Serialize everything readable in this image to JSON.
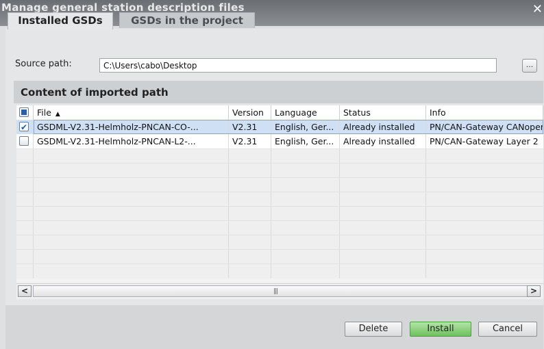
{
  "window": {
    "title": "Manage general station description files"
  },
  "tabs": [
    {
      "label": "Installed GSDs",
      "active": true
    },
    {
      "label": "GSDs in the project",
      "active": false
    }
  ],
  "source": {
    "label": "Source path:",
    "value": "C:\\Users\\cabo\\Desktop",
    "browse_label": "..."
  },
  "section": {
    "title": "Content of imported path"
  },
  "table": {
    "columns": [
      "File",
      "Version",
      "Language",
      "Status",
      "Info"
    ],
    "sort": {
      "column": "File",
      "direction": "ascending"
    },
    "rows": [
      {
        "checked": true,
        "selected": true,
        "file": "GSDML-V2.31-Helmholz-PNCAN-CO-...",
        "version": "V2.31",
        "language": "English, Ger...",
        "status": "Already installed",
        "info": "PN/CAN-Gateway CANopen"
      },
      {
        "checked": false,
        "selected": false,
        "file": "GSDML-V2.31-Helmholz-PNCAN-L2-...",
        "version": "V2.31",
        "language": "English, Ger...",
        "status": "Already installed",
        "info": "PN/CAN-Gateway Layer 2"
      }
    ]
  },
  "buttons": {
    "delete": "Delete",
    "install": "Install",
    "cancel": "Cancel"
  },
  "colors": {
    "accent_install": "#6cc25c",
    "selection": "#cfe0f5",
    "titlebar": "#6a6e72"
  }
}
